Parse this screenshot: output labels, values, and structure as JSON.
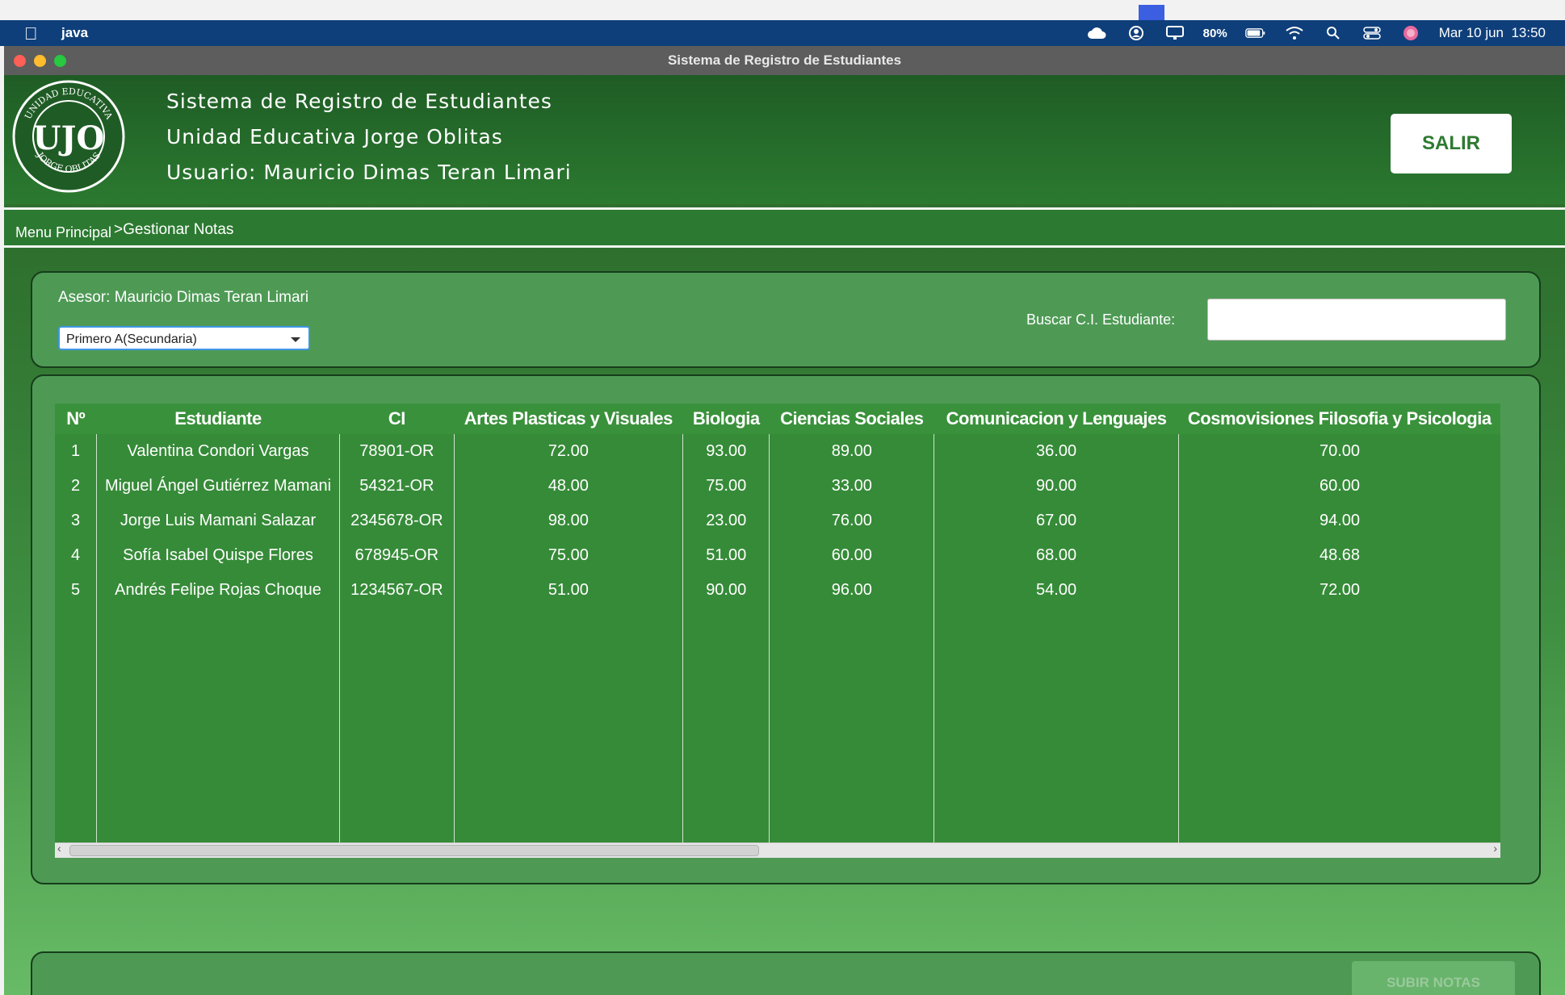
{
  "menubar": {
    "app_name": "java",
    "battery": "80%",
    "datetime": "Mar 10 jun  13:50"
  },
  "window": {
    "title": "Sistema de Registro de Estudiantes"
  },
  "header": {
    "line1": "Sistema de Registro de Estudiantes",
    "line2": "Unidad Educativa Jorge Oblitas",
    "line3": "Usuario: Mauricio Dimas Teran Limari",
    "logo_text_top": "UNIDAD EDUCATIVA",
    "logo_text_bottom": "JORGE OBLITAS",
    "logo_monogram": "UJO",
    "exit_label": "SALIR"
  },
  "breadcrumb": {
    "home": "Menu Principal",
    "current": ">Gestionar Notas"
  },
  "filters": {
    "asesor": "Asesor: Mauricio Dimas Teran Limari",
    "course_selected": "Primero A(Secundaria)",
    "search_label": "Buscar C.I. Estudiante:",
    "search_value": ""
  },
  "grades_table": {
    "columns": [
      "Nº",
      "Estudiante",
      "CI",
      "Artes Plasticas y Visuales",
      "Biologia",
      "Ciencias Sociales",
      "Comunicacion y Lenguajes",
      "Cosmovisiones Filosofia y Psicologia"
    ],
    "rows": [
      [
        "1",
        "Valentina Condori Vargas",
        "78901-OR",
        "72.00",
        "93.00",
        "89.00",
        "36.00",
        "70.00"
      ],
      [
        "2",
        "Miguel Ángel Gutiérrez Mamani",
        "54321-OR",
        "48.00",
        "75.00",
        "33.00",
        "90.00",
        "60.00"
      ],
      [
        "3",
        "Jorge Luis Mamani Salazar",
        "2345678-OR",
        "98.00",
        "23.00",
        "76.00",
        "67.00",
        "94.00"
      ],
      [
        "4",
        "Sofía Isabel Quispe Flores",
        "678945-OR",
        "75.00",
        "51.00",
        "60.00",
        "68.00",
        "48.68"
      ],
      [
        "5",
        "Andrés Felipe Rojas Choque",
        "1234567-OR",
        "51.00",
        "90.00",
        "96.00",
        "54.00",
        "72.00"
      ]
    ]
  },
  "actions": {
    "upload_label": "SUBIR NOTAS"
  },
  "colors": {
    "header_green": "#2b7a30",
    "panel_green": "#4e9a55",
    "table_green": "#368b38",
    "menubar_blue": "#0f3f7a"
  }
}
